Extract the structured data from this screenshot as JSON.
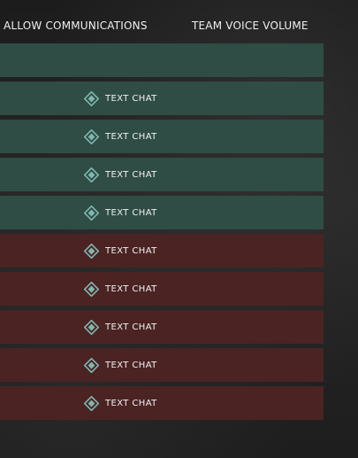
{
  "header": {
    "allow_communications": "ALLOW COMMUNICATIONS",
    "team_voice_volume": "TEAM VOICE VOLUME"
  },
  "colors": {
    "team_green_row": "#2f4d44",
    "team_red_row": "#4b2323",
    "icon_fill": "#7fb7b0"
  },
  "rows": [
    {
      "team": "green",
      "chat_label": ""
    },
    {
      "team": "green",
      "chat_label": "TEXT CHAT"
    },
    {
      "team": "green",
      "chat_label": "TEXT CHAT"
    },
    {
      "team": "green",
      "chat_label": "TEXT CHAT"
    },
    {
      "team": "green",
      "chat_label": "TEXT CHAT"
    },
    {
      "team": "red",
      "chat_label": "TEXT CHAT"
    },
    {
      "team": "red",
      "chat_label": "TEXT CHAT"
    },
    {
      "team": "red",
      "chat_label": "TEXT CHAT"
    },
    {
      "team": "red",
      "chat_label": "TEXT CHAT"
    },
    {
      "team": "red",
      "chat_label": "TEXT CHAT"
    }
  ],
  "icons": {
    "chat_toggle": "diamond-chat-icon"
  }
}
